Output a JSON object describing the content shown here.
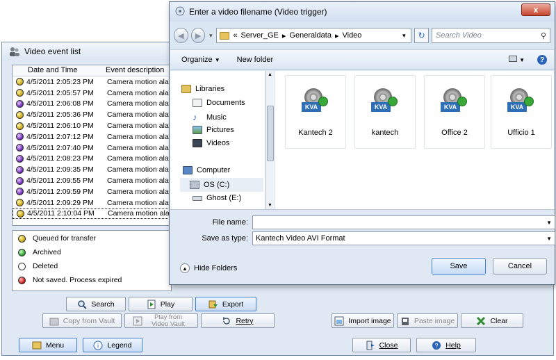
{
  "background_window": {
    "title": "Video event list",
    "table": {
      "columns": [
        "Date and Time",
        "Event description"
      ],
      "rows": [
        {
          "color": "yellow",
          "datetime": "4/5/2011 2:05:23 PM",
          "description": "Camera motion ala"
        },
        {
          "color": "yellow",
          "datetime": "4/5/2011 2:05:57 PM",
          "description": "Camera motion ala"
        },
        {
          "color": "purple",
          "datetime": "4/5/2011 2:06:08 PM",
          "description": "Camera motion ala"
        },
        {
          "color": "yellow",
          "datetime": "4/5/2011 2:05:36 PM",
          "description": "Camera motion ala"
        },
        {
          "color": "yellow",
          "datetime": "4/5/2011 2:06:10 PM",
          "description": "Camera motion ala"
        },
        {
          "color": "purple",
          "datetime": "4/5/2011 2:07:12 PM",
          "description": "Camera motion ala"
        },
        {
          "color": "purple",
          "datetime": "4/5/2011 2:07:40 PM",
          "description": "Camera motion ala"
        },
        {
          "color": "purple",
          "datetime": "4/5/2011 2:08:23 PM",
          "description": "Camera motion ala"
        },
        {
          "color": "purple",
          "datetime": "4/5/2011 2:09:35 PM",
          "description": "Camera motion ala"
        },
        {
          "color": "purple",
          "datetime": "4/5/2011 2:09:55 PM",
          "description": "Camera motion ala"
        },
        {
          "color": "purple",
          "datetime": "4/5/2011 2:09:59 PM",
          "description": "Camera motion ala"
        },
        {
          "color": "yellow",
          "datetime": "4/5/2011 2:09:29 PM",
          "description": "Camera motion ala"
        },
        {
          "color": "yellow",
          "datetime": "4/5/2011 2:10:04 PM",
          "description": "Camera motion ala"
        }
      ]
    },
    "legend": [
      {
        "color": "yellow",
        "label": "Queued for transfer"
      },
      {
        "color": "green",
        "label": "Archived"
      },
      {
        "color": "white",
        "label": "Deleted"
      },
      {
        "color": "red",
        "label": "Not saved. Process expired"
      }
    ],
    "buttons": {
      "search": "Search",
      "play": "Play",
      "export": "Export",
      "copy_from_vault": "Copy from Vault",
      "play_from_video_vault": "Play from Video Vault",
      "retry": "Retry",
      "import_image": "Import image",
      "paste_image": "Paste image",
      "clear": "Clear",
      "menu": "Menu",
      "legend": "Legend",
      "close": "Close",
      "help": "Help"
    }
  },
  "dialog": {
    "title": "Enter a video filename (Video trigger)",
    "close_glyph": "x",
    "breadcrumb": [
      "«",
      "Server_GE",
      "Generaldata",
      "Video"
    ],
    "search_placeholder": "Search Video",
    "toolbar": {
      "organize": "Organize",
      "new_folder": "New folder"
    },
    "nav": {
      "libraries": "Libraries",
      "documents": "Documents",
      "music": "Music",
      "pictures": "Pictures",
      "videos": "Videos",
      "computer": "Computer",
      "os_c": "OS (C:)",
      "ghost_e": "Ghost (E:)"
    },
    "files": [
      "Kantech 2",
      "kantech",
      "Office 2",
      "Ufficio 1"
    ],
    "file_icon_text": "KVA",
    "file_name_label": "File name:",
    "file_name_value": "",
    "save_as_type_label": "Save as type:",
    "save_as_type_value": "Kantech Video AVI Format",
    "hide_folders": "Hide Folders",
    "save": "Save",
    "cancel": "Cancel"
  }
}
